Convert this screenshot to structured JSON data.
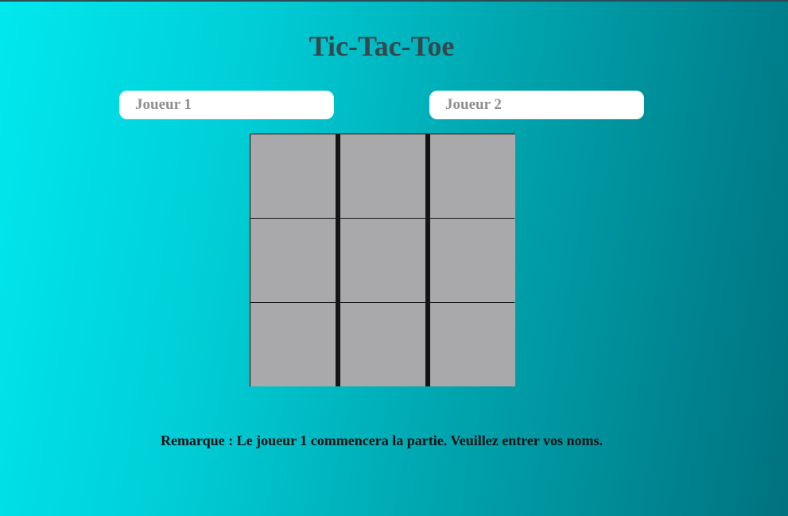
{
  "title": "Tic-Tac-Toe",
  "players": {
    "player1_placeholder": "Joueur 1",
    "player1_value": "",
    "player2_placeholder": "Joueur 2",
    "player2_value": ""
  },
  "board": {
    "rows": 3,
    "cols": 3,
    "cells": [
      "",
      "",
      "",
      "",
      "",
      "",
      "",
      "",
      ""
    ],
    "cell_color": "#a9a8aa",
    "line_color": "#141414"
  },
  "note": "Remarque : Le joueur 1 commencera la partie. Veuillez entrer vos noms.",
  "colors": {
    "background_start": "#00e8ee",
    "background_end": "#00727f",
    "title": "#34494d"
  }
}
